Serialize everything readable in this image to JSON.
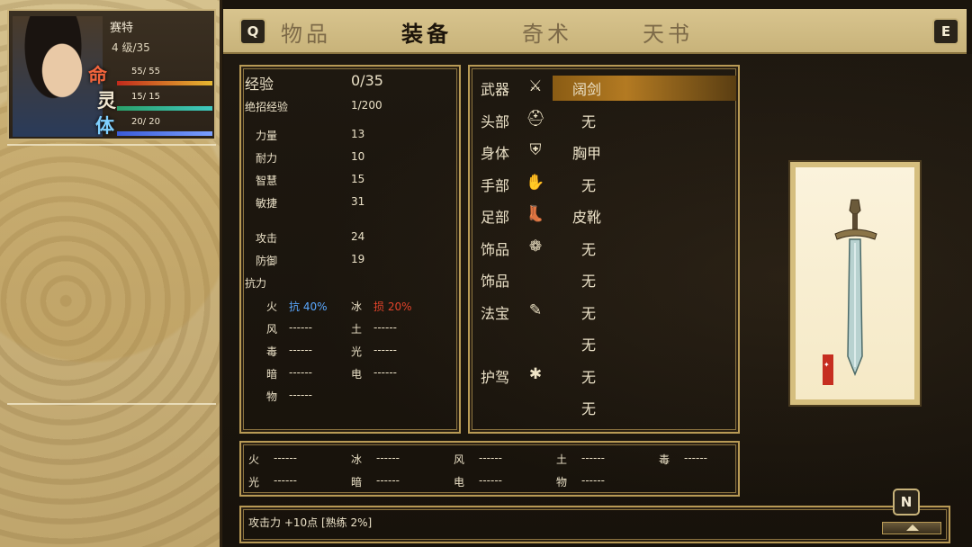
{
  "tabs": {
    "prev_key": "Q",
    "next_key": "E",
    "items": [
      {
        "label": "物品",
        "active": false
      },
      {
        "label": "装备",
        "active": true
      },
      {
        "label": "奇术",
        "active": false
      },
      {
        "label": "天书",
        "active": false
      }
    ]
  },
  "character": {
    "name": "赛特",
    "level": "4 级/35",
    "ming": "命",
    "ling": "灵",
    "ti": "体",
    "hp": "55/ 55",
    "mp": "15/ 15",
    "sp": "20/ 20"
  },
  "stats": {
    "exp_label": "经验",
    "exp_value": "0/35",
    "skill_exp_label": "绝招经验",
    "skill_exp_value": "1/200",
    "strength_label": "力量",
    "strength_value": "13",
    "endurance_label": "耐力",
    "endurance_value": "10",
    "wisdom_label": "智慧",
    "wisdom_value": "15",
    "agility_label": "敏捷",
    "agility_value": "31",
    "attack_label": "攻击",
    "attack_value": "24",
    "defense_label": "防御",
    "defense_value": "19",
    "resist_label": "抗力",
    "resist": {
      "fire_label": "火",
      "fire_value_prefix": "抗",
      "fire_value": "40%",
      "ice_label": "冰",
      "ice_value_prefix": "损",
      "ice_value": "20%",
      "wind_label": "风",
      "wind_value": "------",
      "earth_label": "土",
      "earth_value": "------",
      "poison_label": "毒",
      "poison_value": "------",
      "light_label": "光",
      "light_value": "------",
      "dark_label": "暗",
      "dark_value": "------",
      "electric_label": "电",
      "electric_value": "------",
      "physical_label": "物",
      "physical_value": "------"
    }
  },
  "equipment": [
    {
      "slot": "武器",
      "icon": "sword-icon",
      "glyph": "⚔",
      "value": "阔剑",
      "selected": true
    },
    {
      "slot": "头部",
      "icon": "helmet-icon",
      "glyph": "⛑",
      "value": "无"
    },
    {
      "slot": "身体",
      "icon": "armor-icon",
      "glyph": "⛨",
      "value": "胸甲"
    },
    {
      "slot": "手部",
      "icon": "glove-icon",
      "glyph": "✋",
      "value": "无"
    },
    {
      "slot": "足部",
      "icon": "boot-icon",
      "glyph": "👢",
      "value": "皮靴"
    },
    {
      "slot": "饰品",
      "icon": "ring-icon",
      "glyph": "❁",
      "value": "无"
    },
    {
      "slot": "饰品",
      "icon": "",
      "glyph": "",
      "value": "无"
    },
    {
      "slot": "法宝",
      "icon": "scroll-icon",
      "glyph": "✎",
      "value": "无"
    },
    {
      "slot": "",
      "icon": "",
      "glyph": "",
      "value": "无"
    },
    {
      "slot": "护驾",
      "icon": "guardian-icon",
      "glyph": "✱",
      "value": "无"
    },
    {
      "slot": "",
      "icon": "",
      "glyph": "",
      "value": "无"
    }
  ],
  "item_resist": {
    "fire_label": "火",
    "fire_value": "------",
    "ice_label": "冰",
    "ice_value": "------",
    "wind_label": "风",
    "wind_value": "------",
    "earth_label": "土",
    "earth_value": "------",
    "poison_label": "毒",
    "poison_value": "------",
    "light_label": "光",
    "light_value": "------",
    "dark_label": "暗",
    "dark_value": "------",
    "electric_label": "电",
    "electric_value": "------",
    "physical_label": "物",
    "physical_value": "------"
  },
  "description": "攻击力 +10点 [熟练 2%]",
  "n_key": "N",
  "colors": {
    "selection": "#b37a22",
    "frame_gold": "#b89a55",
    "resist_positive": "#5aa8ff",
    "resist_negative": "#e2432a"
  }
}
